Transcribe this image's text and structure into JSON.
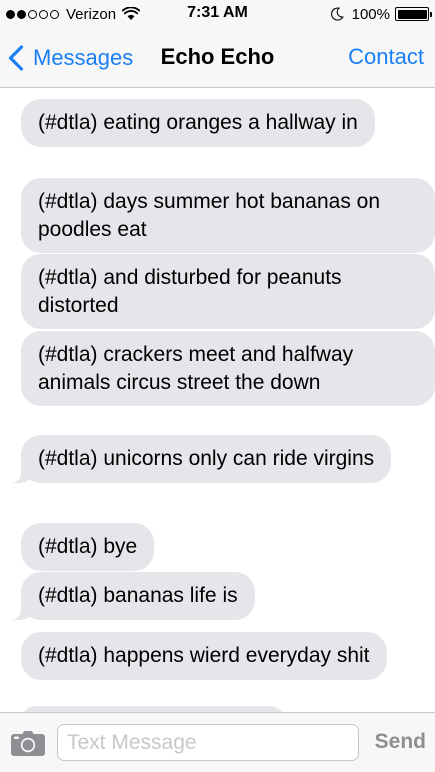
{
  "status_bar": {
    "carrier": "Verizon",
    "time": "7:31 AM",
    "battery_percent": "100%",
    "signal_bars_filled": 2,
    "signal_bars_total": 5,
    "battery_level": 1.0
  },
  "nav": {
    "back_label": "Messages",
    "title": "Echo Echo",
    "right_label": "Contact"
  },
  "messages": [
    {
      "text": "(#dtla) eating oranges a hallway in"
    },
    {
      "text": "(#dtla) days summer hot bananas on poodles eat"
    },
    {
      "text": "(#dtla) and disturbed for peanuts distorted"
    },
    {
      "text": "(#dtla) crackers meet and halfway animals circus street the down"
    },
    {
      "text": "(#dtla) unicorns only can ride virgins"
    },
    {
      "text": "(#dtla) bye"
    },
    {
      "text": "(#dtla) bananas life is"
    },
    {
      "text": "(#dtla) happens wierd everyday shit"
    }
  ],
  "composer": {
    "placeholder": "Text Message",
    "value": "",
    "send_label": "Send"
  },
  "colors": {
    "accent": "#1a7ff5",
    "bubble_incoming": "#e5e5ea",
    "bar_background": "#f7f7f8",
    "send_disabled": "#8e8e93"
  },
  "icons": {
    "back": "chevron-left-icon",
    "camera": "camera-icon",
    "wifi": "wifi-icon",
    "do_not_disturb": "moon-icon",
    "battery": "battery-icon"
  }
}
